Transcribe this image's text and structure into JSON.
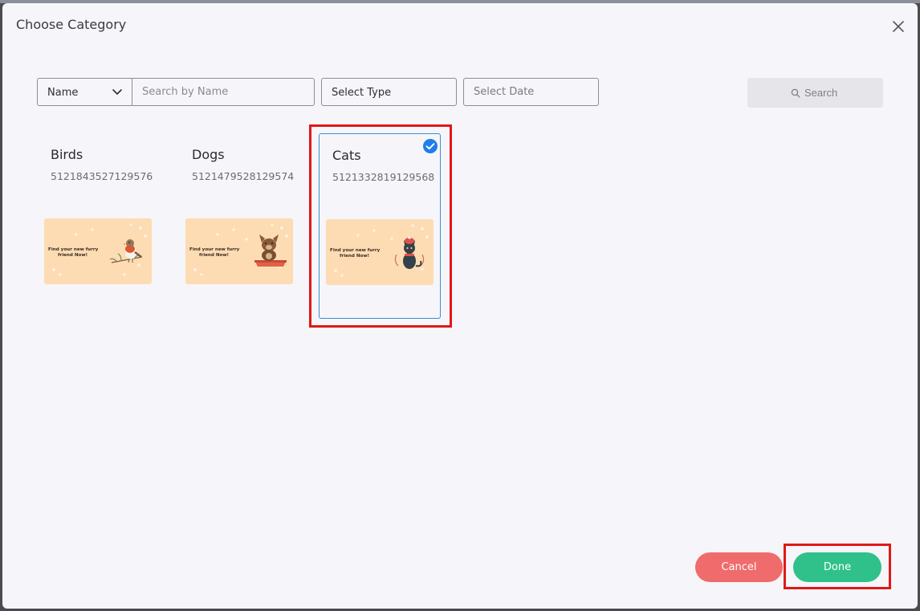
{
  "dialog": {
    "title": "Choose Category"
  },
  "filters": {
    "field_select": "Name",
    "search_placeholder": "Search by Name",
    "type_select": "Select Type",
    "date_placeholder": "Select Date",
    "search_button": "Search"
  },
  "categories": [
    {
      "name": "Birds",
      "code": "5121843527129576",
      "selected": false,
      "thumb_text": [
        "Find your new furry",
        "friend Now!"
      ]
    },
    {
      "name": "Dogs",
      "code": "5121479528129574",
      "selected": false,
      "thumb_text": [
        "Find your new furry",
        "friend Now!"
      ]
    },
    {
      "name": "Cats",
      "code": "5121332819129568",
      "selected": true,
      "thumb_text": [
        "Find your new furry",
        "friend Now!"
      ]
    }
  ],
  "footer": {
    "cancel_label": "Cancel",
    "done_label": "Done"
  },
  "colors": {
    "dialog_bg": "#f6f5f9",
    "thumb_bg": "#fddcb4",
    "selected_border": "#3b8ed4",
    "check_blue": "#1f7ee8",
    "cancel_red": "#f06b6b",
    "done_green": "#30c18a",
    "highlight_red": "#e01818"
  },
  "icons": {
    "close": "close-icon",
    "chevron": "chevron-down-icon",
    "search": "search-icon",
    "check": "check-circle-icon"
  }
}
